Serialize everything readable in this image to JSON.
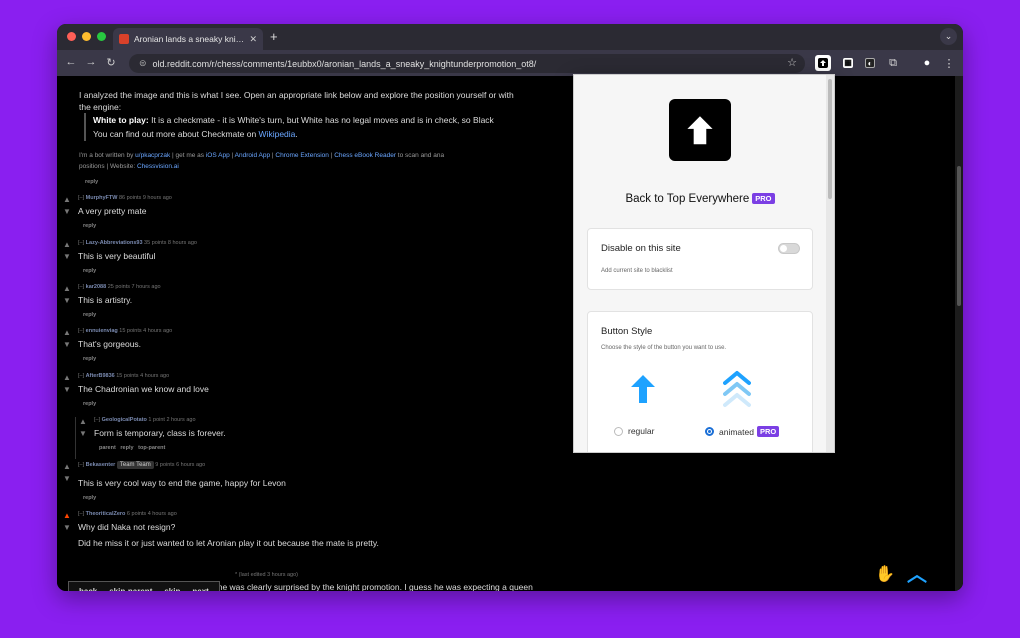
{
  "browser": {
    "tab_title": "Aronian lands a sneaky knigh",
    "url": "old.reddit.com/r/chess/comments/1eubbx0/aronian_lands_a_sneaky_knightunderpromotion_ot8/"
  },
  "bot_comment": {
    "intro": "I analyzed the image and this is what I see. Open an appropriate link below and explore the position yourself or with",
    "intro2": "the engine:",
    "quote_label": "White to play:",
    "quote_text": " It is a checkmate - it is White's turn, but White has no legal moves and is in check, so Black",
    "quote_line2_pre": "You can find out more about Checkmate on ",
    "quote_link": "Wikipedia",
    "quote_line2_post": ".",
    "links_line1_pre": "I'm a bot written by ",
    "links_user": "u/pkacprzak",
    "links_mid": " | get me as ",
    "link_ios": "iOS App",
    "link_android": "Android App",
    "link_chrome": "Chrome Extension",
    "link_ebook": "Chess eBook Reader",
    "links_tail": " to scan and ana",
    "links_line2_pre": "positions | Website: ",
    "link_site": "Chessvision.ai",
    "reply": "reply"
  },
  "comments": [
    {
      "user": "MurphyFTW",
      "meta": "86 points 9 hours ago",
      "text": "A very pretty mate",
      "reply": "reply"
    },
    {
      "user": "Lazy-Abbreviations93",
      "meta": "35 points 8 hours ago",
      "text": "This is very beautiful",
      "reply": "reply"
    },
    {
      "user": "kar2088",
      "meta": "25 points 7 hours ago",
      "text": "This is artistry.",
      "reply": "reply"
    },
    {
      "user": "ennuienviag",
      "meta": "15 points 4 hours ago",
      "text": "That's gorgeous.",
      "reply": "reply"
    },
    {
      "user": "AfterB9836",
      "meta": "15 points 4 hours ago",
      "text": "The Chadronian we know and love",
      "reply": "reply"
    },
    {
      "user": "GeologicalPotato",
      "meta": "1 point 2 hours ago",
      "text": "Form is temporary, class is forever.",
      "reply": "parent   reply   top-parent"
    },
    {
      "user": "Bekasenter",
      "flair": "Team Team",
      "meta": "9 points 6 hours ago",
      "text": "This is very cool way to end the game, happy for Levon",
      "reply": "reply"
    },
    {
      "user": "TheoriticalZero",
      "meta": "6 points 4 hours ago",
      "text": "Why did Naka not resign?",
      "text2": "Did he miss it or just wanted to let Aronian play it out because the mate is pretty.",
      "reply": ""
    }
  ],
  "last_comment": {
    "meta": "* (last edited 3 hours ago)",
    "text": "From seeing it happen live I'd say he was clearly surprised by the knight promotion. I guess he was expecting a queen"
  },
  "footer": {
    "back": "back",
    "skip_parent": "skip-parent",
    "skip": "skip",
    "next": "next"
  },
  "popup": {
    "title": "Back to Top Everywhere",
    "pro": "PRO",
    "disable_title": "Disable on this site",
    "disable_sub": "Add current site to blacklist",
    "style_title": "Button Style",
    "style_sub": "Choose the style of the button you want to use.",
    "option_regular": "regular",
    "option_animated": "animated",
    "selected": "animated"
  },
  "colors": {
    "accent": "#1ea2ff",
    "pro_badge": "#7b3fe4",
    "radio_selected": "#1b6fd6",
    "background": "#8a1ff0"
  }
}
